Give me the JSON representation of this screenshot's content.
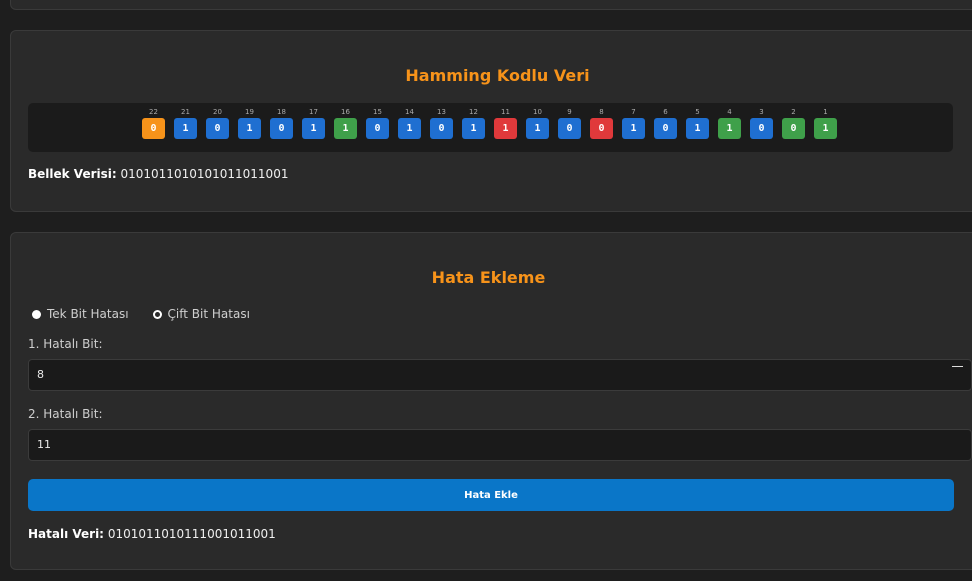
{
  "colors": {
    "accent_title": "#f7931a",
    "bit_data": "#1f6fd1",
    "bit_parity": "#3fa04a",
    "bit_error": "#e0393b",
    "bit_overall": "#f7931a",
    "button": "#0a76c8"
  },
  "hamming": {
    "title": "Hamming Kodlu Veri",
    "bits": [
      {
        "index": "22",
        "value": "0",
        "kind": "overall"
      },
      {
        "index": "21",
        "value": "1",
        "kind": "data"
      },
      {
        "index": "20",
        "value": "0",
        "kind": "data"
      },
      {
        "index": "19",
        "value": "1",
        "kind": "data"
      },
      {
        "index": "18",
        "value": "0",
        "kind": "data"
      },
      {
        "index": "17",
        "value": "1",
        "kind": "data"
      },
      {
        "index": "16",
        "value": "1",
        "kind": "parity"
      },
      {
        "index": "15",
        "value": "0",
        "kind": "data"
      },
      {
        "index": "14",
        "value": "1",
        "kind": "data"
      },
      {
        "index": "13",
        "value": "0",
        "kind": "data"
      },
      {
        "index": "12",
        "value": "1",
        "kind": "data"
      },
      {
        "index": "11",
        "value": "1",
        "kind": "error"
      },
      {
        "index": "10",
        "value": "1",
        "kind": "data"
      },
      {
        "index": "9",
        "value": "0",
        "kind": "data"
      },
      {
        "index": "8",
        "value": "0",
        "kind": "error"
      },
      {
        "index": "7",
        "value": "1",
        "kind": "data"
      },
      {
        "index": "6",
        "value": "0",
        "kind": "data"
      },
      {
        "index": "5",
        "value": "1",
        "kind": "data"
      },
      {
        "index": "4",
        "value": "1",
        "kind": "parity"
      },
      {
        "index": "3",
        "value": "0",
        "kind": "data"
      },
      {
        "index": "2",
        "value": "0",
        "kind": "parity"
      },
      {
        "index": "1",
        "value": "1",
        "kind": "parity"
      }
    ],
    "memory_label": "Bellek Verisi:",
    "memory_value": "0101011010101011011001"
  },
  "error_injection": {
    "title": "Hata Ekleme",
    "options": [
      {
        "label": "Tek Bit Hatası",
        "checked": false
      },
      {
        "label": "Çift Bit Hatası",
        "checked": true
      }
    ],
    "bit1_label": "1. Hatalı Bit:",
    "bit1_value": "8",
    "bit2_label": "2. Hatalı Bit:",
    "bit2_value": "11",
    "button_label": "Hata Ekle",
    "result_label": "Hatalı Veri:",
    "result_value": "0101011010111001011001"
  }
}
